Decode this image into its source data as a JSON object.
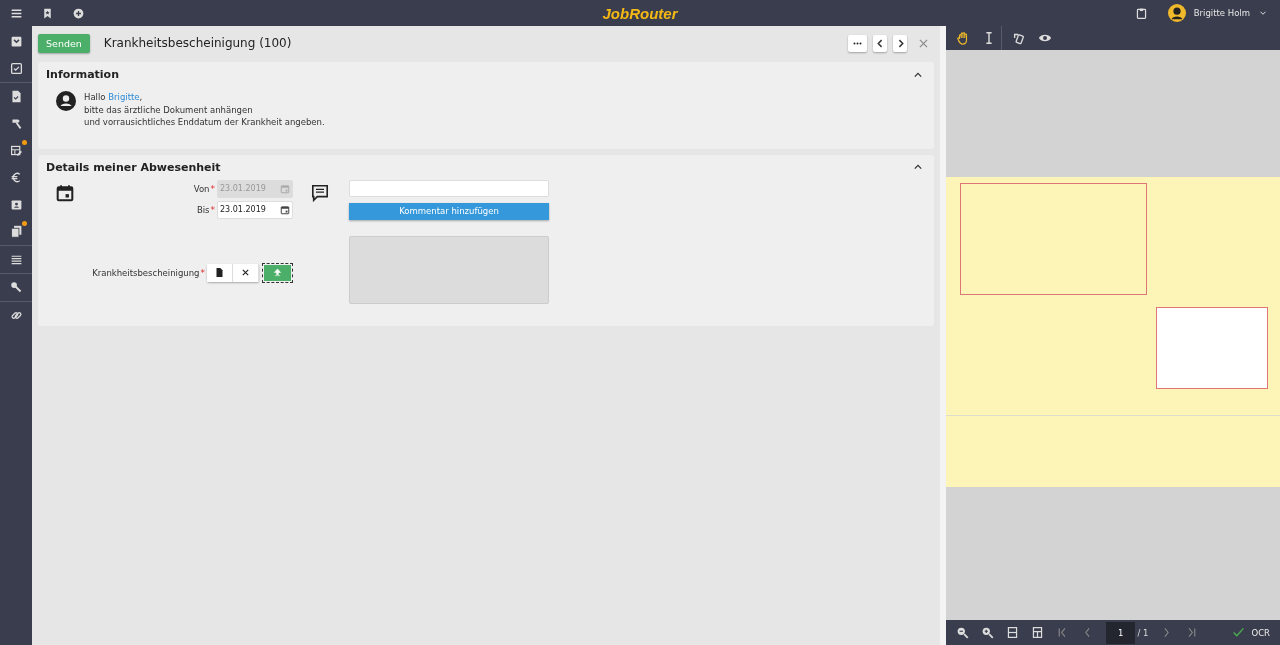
{
  "topbar": {
    "logo": "JobRouter",
    "user": "Brigitte Holm"
  },
  "sidebar": {
    "items": [
      {
        "kind": "inbox",
        "notification": false
      },
      {
        "kind": "check",
        "notification": false
      },
      {
        "kind": "document",
        "notification": false
      },
      {
        "kind": "hammer",
        "notification": false
      },
      {
        "kind": "table",
        "notification": true
      },
      {
        "kind": "euro",
        "notification": false
      },
      {
        "kind": "badge",
        "notification": false
      },
      {
        "kind": "copy",
        "notification": true
      },
      {
        "kind": "list",
        "notification": false
      },
      {
        "kind": "wrench",
        "notification": false
      },
      {
        "kind": "link",
        "notification": false
      }
    ]
  },
  "step": {
    "send_button": "Senden",
    "title": "Krankheitsbescheinigung (100)"
  },
  "information": {
    "title": "Information",
    "greeting": "Hallo",
    "name": "Brigitte",
    "greeting_end": ",",
    "lines": [
      "bitte das ärztliche Dokument anhängen",
      "und vorrausichtliches Enddatum der Krankheit angeben."
    ]
  },
  "details": {
    "title": "Details meiner Abwesenheit",
    "fields": [
      {
        "label": "Von",
        "value": "23.01.2019",
        "required_mark": "*",
        "disabled": true
      },
      {
        "label": "Bis",
        "value": "23.01.2019",
        "required_mark": "*",
        "disabled": false
      }
    ],
    "attachment": {
      "label": "Krankheitsbescheinigung",
      "required_mark": "*"
    },
    "comment": {
      "button": "Kommentar hinzufügen"
    }
  },
  "viewer": {
    "tools": [
      {
        "kind": "hand",
        "selected": true
      },
      {
        "kind": "text",
        "selected": false
      },
      {
        "kind": "rotate",
        "selected": false
      },
      {
        "kind": "eye",
        "selected": false
      }
    ],
    "page": "1",
    "total": "/ 1",
    "ocr": {
      "label": "OCR",
      "checked": true
    }
  }
}
